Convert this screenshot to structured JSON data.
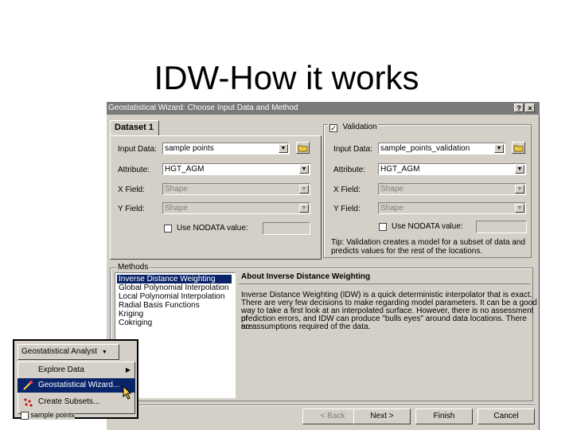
{
  "slide": {
    "title": "IDW-How it works"
  },
  "dialog": {
    "title": "Geostatistical Wizard: Choose Input Data and Method",
    "help_btn": "?",
    "close_btn": "×",
    "tab_label": "Dataset 1",
    "left": {
      "input_label": "Input Data:",
      "input_value": "sample points",
      "attribute_label": "Attribute:",
      "attribute_value": "HGT_AGM",
      "xfield_label": "X Field:",
      "xfield_value": "Shape",
      "yfield_label": "Y Field:",
      "yfield_value": "Shape",
      "nodata_label": "Use NODATA value:",
      "nodata_checked": false
    },
    "validation": {
      "label": "Validation",
      "checked": true,
      "input_label": "Input Data:",
      "input_value": "sample_points_validation",
      "attribute_label": "Attribute:",
      "attribute_value": "HGT_AGM",
      "xfield_label": "X Field:",
      "xfield_value": "Shape",
      "yfield_label": "Y Field:",
      "yfield_value": "Shape",
      "nodata_label": "Use NODATA value:",
      "tip_line1": "Tip: Validation creates a model for a subset of data and",
      "tip_line2": "predicts values for the rest of the locations."
    },
    "methods": {
      "label": "Methods",
      "items": [
        "Inverse Distance Weighting",
        "Global Polynomial Interpolation",
        "Local Polynomial Interpolation",
        "Radial Basis Functions",
        "Kriging",
        "Cokriging"
      ],
      "selected_index": 0
    },
    "about": {
      "title": "About Inverse Distance Weighting",
      "lines": [
        "Inverse Distance Weighting (IDW) is a quick deterministic interpolator that is exact.",
        "There are very few decisions to make regarding model parameters. It can be a good",
        "way to take a first look at an interpolated surface. However, there is no assessment of",
        "prediction errors, and IDW can produce \"bulls eyes\" around data locations. There are",
        "no assumptions required of the data."
      ]
    },
    "buttons": {
      "back": "< Back",
      "next": "Next >",
      "finish": "Finish",
      "cancel": "Cancel"
    }
  },
  "popup": {
    "toolbar_label": "Geostatistical Analyst",
    "toolbar_arrow": "▼",
    "items": [
      {
        "label": "Explore Data",
        "has_submenu": true
      },
      {
        "label": "Geostatistical Wizard...",
        "highlighted": true
      },
      {
        "label": "Create Subsets..."
      }
    ],
    "layer_label": "sample points"
  },
  "icons": {
    "dropdown": "▼",
    "submenu_arrow": "▶",
    "check": "✓"
  }
}
